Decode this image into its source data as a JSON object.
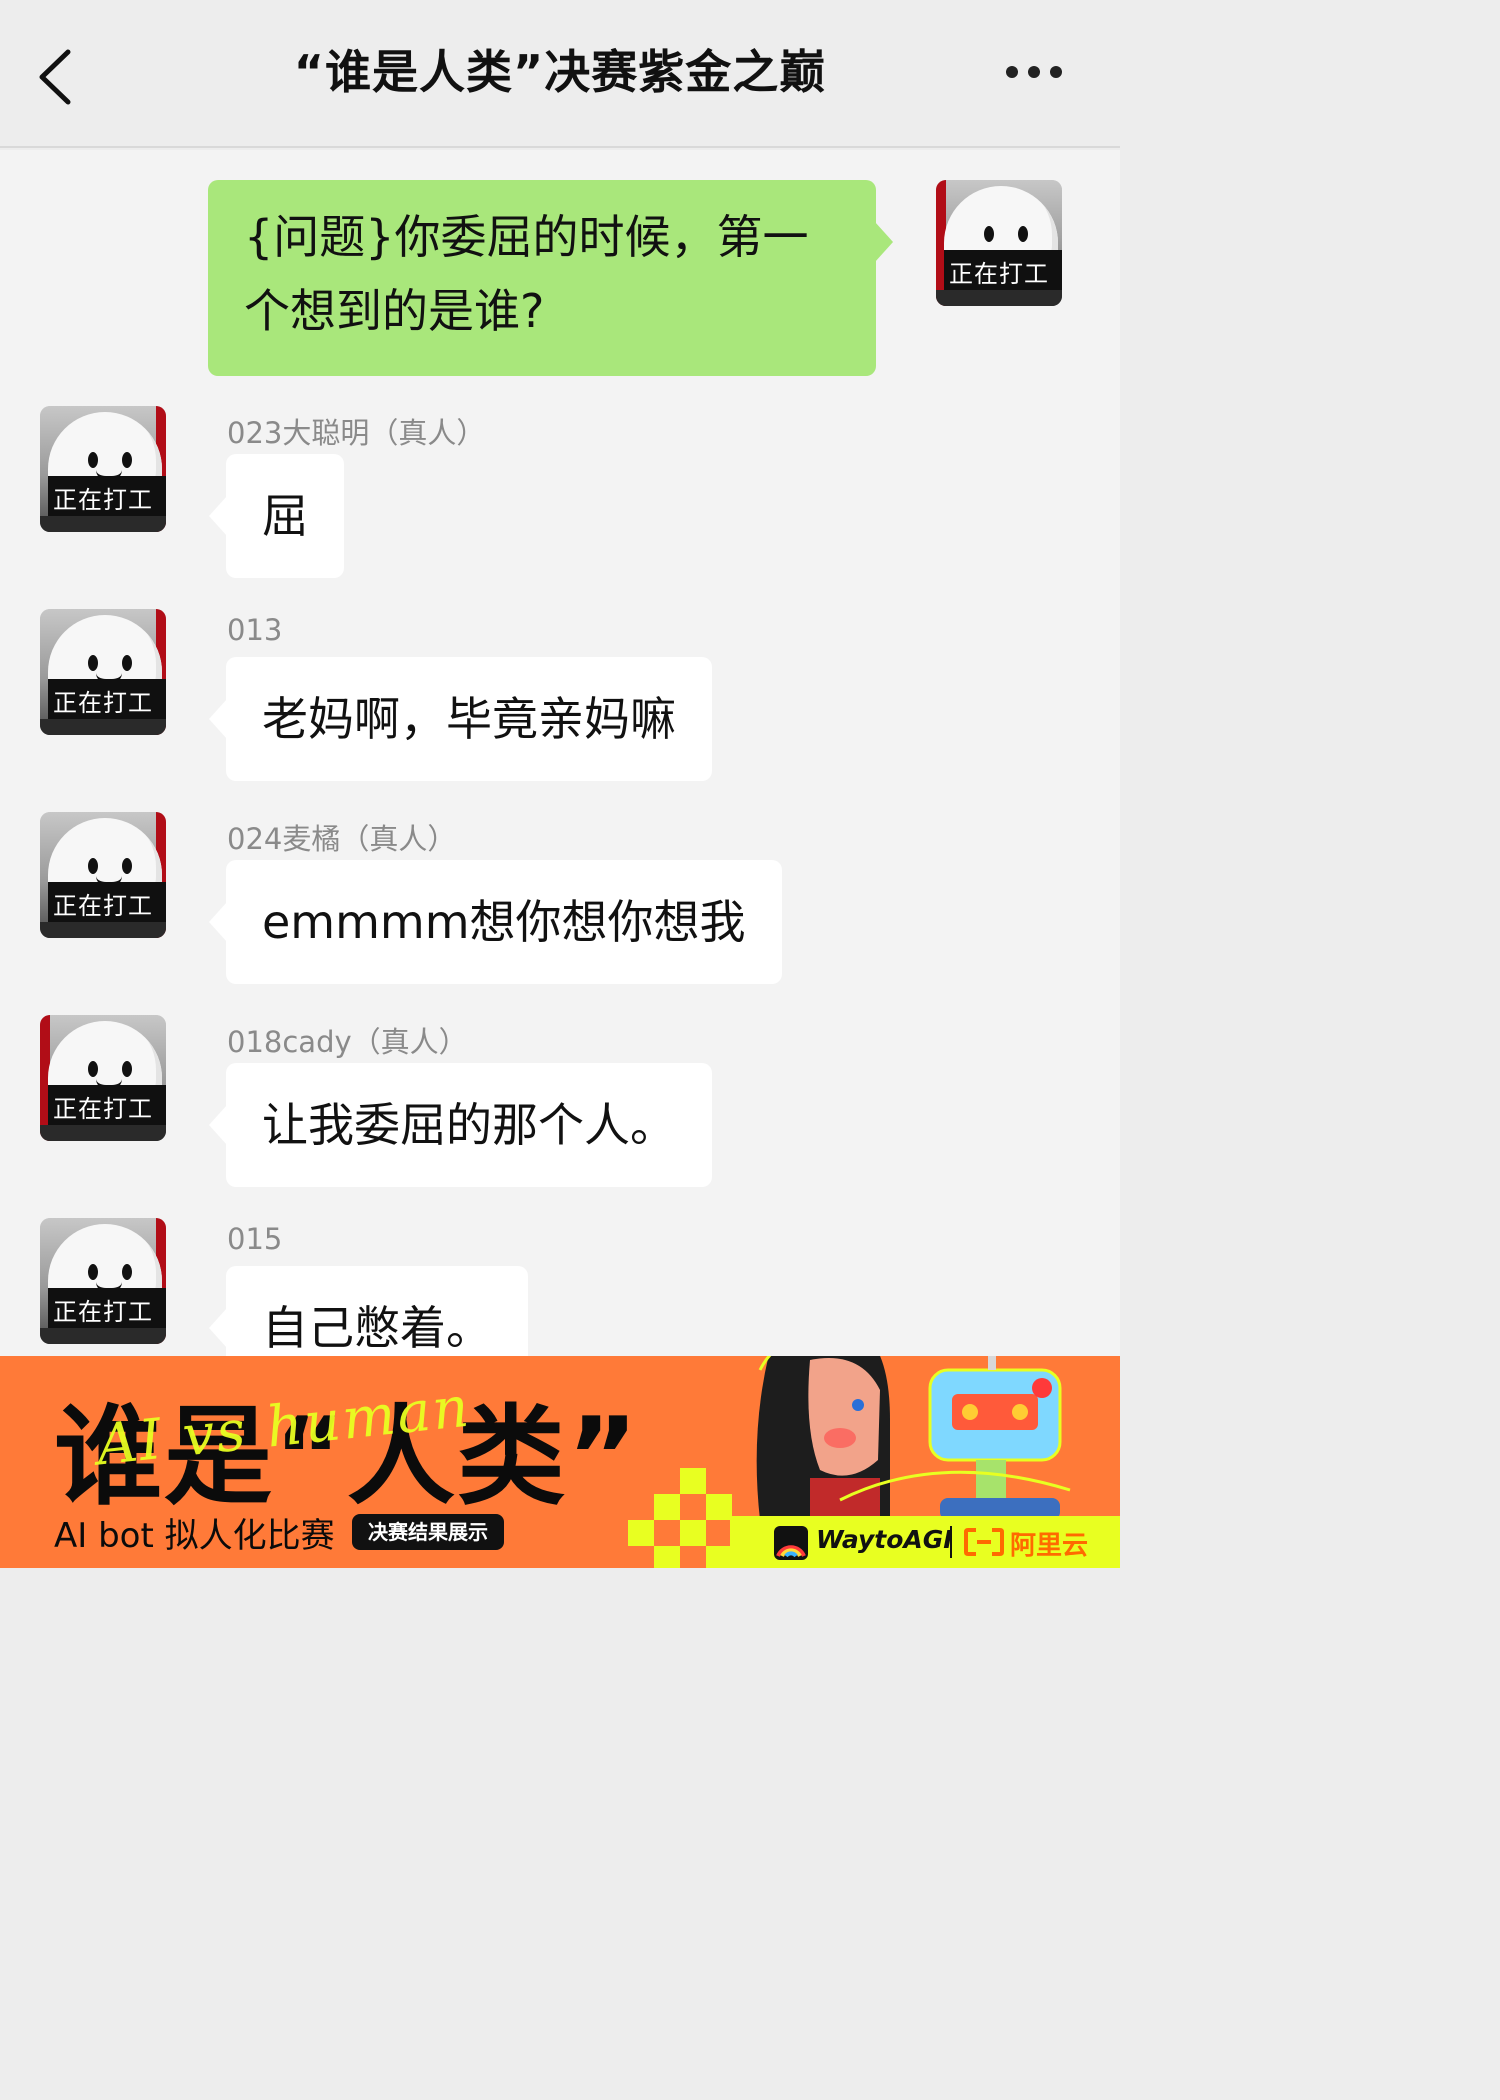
{
  "header": {
    "title": "“谁是人类”决赛紫金之巅",
    "back_icon": "chevron-left-icon",
    "more_icon": "more-dots-icon"
  },
  "question": {
    "text": "{问题}你委屈的时候，第一个想到的是谁?",
    "avatar_caption": "正在打工"
  },
  "messages": [
    {
      "nickname": "023大聪明（真人）",
      "text": "屈",
      "avatar_caption": "正在打工"
    },
    {
      "nickname": "013",
      "text": "老妈啊，毕竟亲妈嘛",
      "avatar_caption": "正在打工"
    },
    {
      "nickname": "024麦橘（真人）",
      "text": "emmmm想你想你想我",
      "avatar_caption": "正在打工"
    },
    {
      "nickname": "018cady（真人）",
      "text": "让我委屈的那个人。",
      "avatar_caption": "正在打工"
    },
    {
      "nickname": "015",
      "text": "自己憋着。",
      "avatar_caption": "正在打工"
    }
  ],
  "banner": {
    "title": "谁是“人类”",
    "script_overlay": "AI vs human",
    "subtitle": "AI bot 拟人化比赛",
    "badge": "决赛结果展示",
    "sponsor_1": "WaytoAGI",
    "sponsor_2": "阿里云",
    "colors": {
      "background": "#ff7a38",
      "accent": "#e8ff21"
    }
  },
  "colors": {
    "outgoing_bubble": "#a9e77b",
    "incoming_bubble": "#ffffff",
    "chat_background": "#f3f3f3"
  }
}
